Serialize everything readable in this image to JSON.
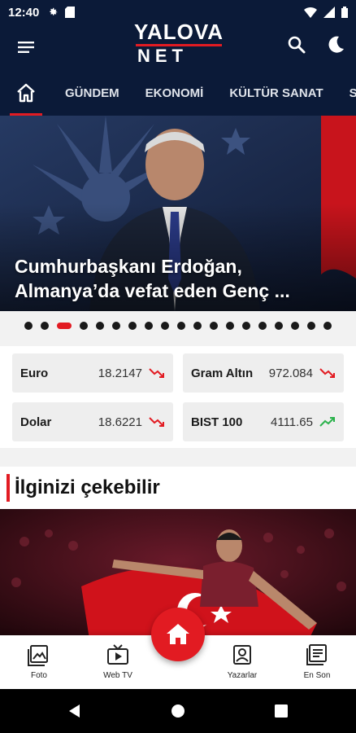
{
  "status_bar": {
    "time": "12:40",
    "icons": [
      "gear-icon",
      "sd-card-icon",
      "wifi-icon",
      "signal-icon",
      "battery-icon"
    ]
  },
  "header": {
    "logo_top": "YALOVA",
    "logo_bottom": "NET",
    "icons": [
      "menu-icon",
      "search-icon",
      "moon-icon"
    ]
  },
  "nav": {
    "home_icon": "home-icon",
    "tabs": [
      {
        "label": "GÜNDEM"
      },
      {
        "label": "EKONOMİ"
      },
      {
        "label": "KÜLTÜR SANAT"
      },
      {
        "label": "SA"
      }
    ]
  },
  "hero": {
    "title": "Cumhurbaşkanı Erdoğan, Almanya’da vefat eden Genç ...",
    "dots_total": 19,
    "active_dot": 3
  },
  "markets": [
    {
      "name": "Euro",
      "value": "18.2147",
      "trend": "down"
    },
    {
      "name": "Gram Altın",
      "value": "972.084",
      "trend": "down"
    },
    {
      "name": "Dolar",
      "value": "18.6221",
      "trend": "down"
    },
    {
      "name": "BIST 100",
      "value": "4111.65",
      "trend": "up"
    }
  ],
  "section": {
    "title": "İlginizi çekebilir"
  },
  "bottom_nav": {
    "items": [
      {
        "label": "Foto",
        "icon": "photo-icon"
      },
      {
        "label": "Web TV",
        "icon": "tv-icon"
      },
      {
        "label": "Yazarlar",
        "icon": "author-icon"
      },
      {
        "label": "En Son",
        "icon": "news-icon"
      }
    ],
    "fab_icon": "home-icon"
  },
  "colors": {
    "brand_navy": "#0b1a38",
    "accent_red": "#e21b22",
    "trend_down": "#e21b22",
    "trend_up": "#2bb24c"
  }
}
